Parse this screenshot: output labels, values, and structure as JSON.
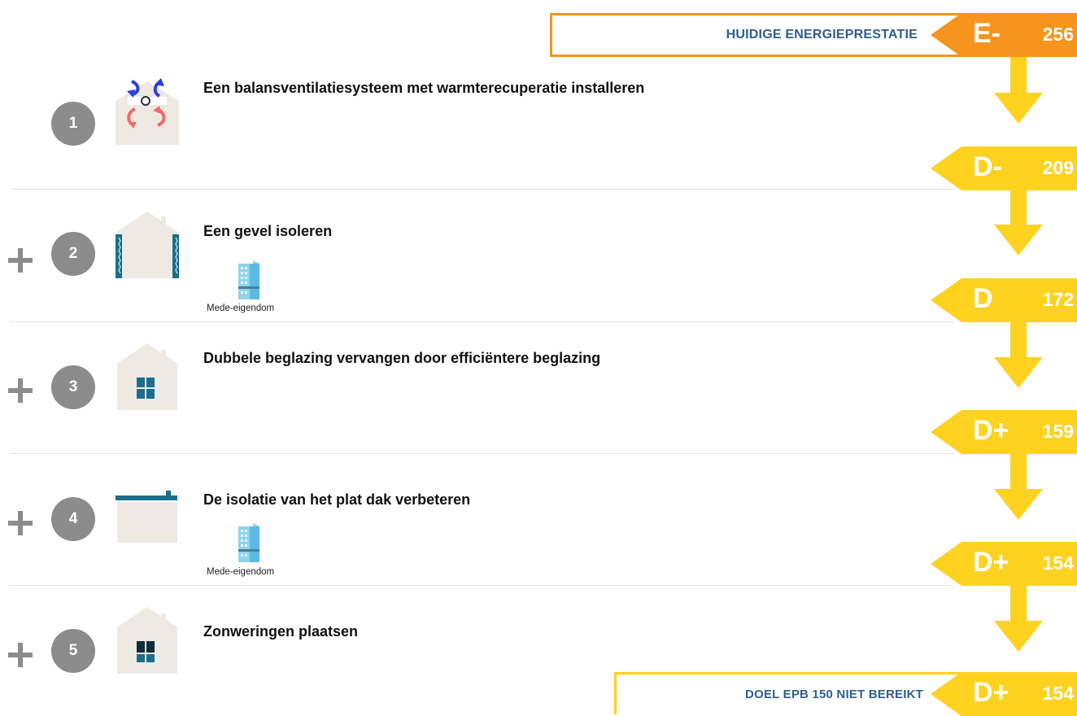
{
  "colors": {
    "orange": "#f7941d",
    "yellow": "#ffd21f",
    "label_blue": "#2f5f8f",
    "circle_grey": "#8c8c8c",
    "house_beige": "#efe9e4",
    "insulation_teal": "#1a6f8c"
  },
  "current": {
    "label": "HUIDIGE ENERGIEPRESTATIE",
    "grade": "E-",
    "score": "256"
  },
  "steps": [
    {
      "number": "1",
      "title": "Een balansventilatiesysteem met warmterecuperatie installeren",
      "icon": "ventilation-icon",
      "result_grade": "D-",
      "result_score": "209"
    },
    {
      "number": "2",
      "title": "Een gevel isoleren",
      "icon": "facade-insulation-icon",
      "co_ownership": "Mede-eigendom",
      "result_grade": "D",
      "result_score": "172"
    },
    {
      "number": "3",
      "title": "Dubbele beglazing vervangen door efficiëntere beglazing",
      "icon": "window-glazing-icon",
      "result_grade": "D+",
      "result_score": "159"
    },
    {
      "number": "4",
      "title": "De isolatie van het plat dak verbeteren",
      "icon": "flat-roof-icon",
      "co_ownership": "Mede-eigendom",
      "result_grade": "D+",
      "result_score": "154"
    },
    {
      "number": "5",
      "title": "Zonweringen plaatsen",
      "icon": "sun-shading-icon"
    }
  ],
  "target": {
    "label": "DOEL EPB 150 NIET BEREIKT",
    "grade": "D+",
    "score": "154"
  }
}
